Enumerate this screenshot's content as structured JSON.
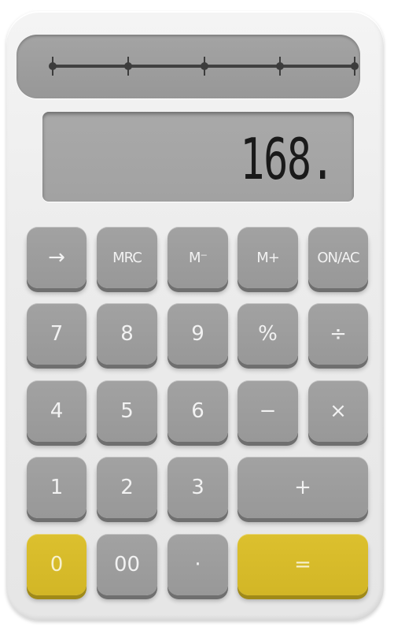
{
  "display": {
    "value": "168."
  },
  "solar_panel": {
    "nodes": 5
  },
  "keys": {
    "arrow": "→",
    "mrc": "MRC",
    "m_minus": "M⁻",
    "m_plus": "M+",
    "on_ac": "ON/AC",
    "seven": "7",
    "eight": "8",
    "nine": "9",
    "percent": "%",
    "divide": "÷",
    "four": "4",
    "five": "5",
    "six": "6",
    "minus": "−",
    "multiply": "×",
    "one": "1",
    "two": "2",
    "three": "3",
    "plus": "+",
    "zero": "0",
    "double_zero": "00",
    "decimal": "·",
    "equals": "="
  },
  "colors": {
    "body": "#ececec",
    "key_gray": "#9c9c9c",
    "key_yellow": "#d6bb2a",
    "display_bg": "#a6a6a6",
    "digit": "#1a1a1a"
  }
}
